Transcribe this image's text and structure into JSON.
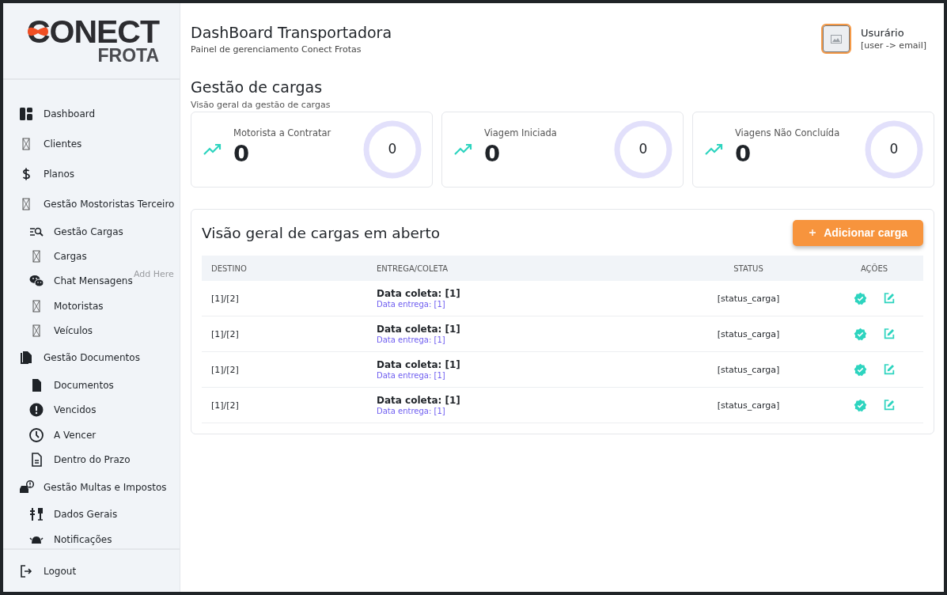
{
  "logo": {
    "wordmark": "CONECT",
    "subtitle": "FROTA"
  },
  "sidebar": {
    "items": [
      {
        "label": "Dashboard",
        "selected": false
      },
      {
        "label": "Clientes",
        "selected": false
      },
      {
        "label": "Planos",
        "selected": false
      },
      {
        "label": "Gestão Mostoristas Terceiro",
        "selected": false,
        "children": [
          {
            "label": "Gestão Cargas",
            "selected": false
          },
          {
            "label": "Cargas",
            "selected": false
          },
          {
            "label": "Chat Mensagens",
            "selected": false,
            "badge": "Add Here"
          },
          {
            "label": "Motoristas",
            "selected": false
          },
          {
            "label": "Veículos",
            "selected": false
          }
        ]
      },
      {
        "label": "Gestão Documentos",
        "selected": false,
        "children": [
          {
            "label": "Documentos",
            "selected": false
          },
          {
            "label": "Vencidos",
            "selected": false
          },
          {
            "label": "A Vencer",
            "selected": false
          },
          {
            "label": "Dentro do Prazo",
            "selected": false
          }
        ]
      },
      {
        "label": "Gestão Multas e Impostos",
        "selected": false,
        "children": [
          {
            "label": "Dados Gerais",
            "selected": false
          },
          {
            "label": "Notificações",
            "selected": false
          }
        ]
      }
    ],
    "footer": "Logout"
  },
  "header": {
    "title": "DashBoard Transportadora",
    "subtitle": "Painel de gerenciamento Conect Frotas"
  },
  "user": {
    "name": "Usurário",
    "email": "[user -> email]"
  },
  "section": {
    "title": "Gestão de cargas",
    "subtitle": "Visão geral da gestão de cargas"
  },
  "stats": [
    {
      "label": "Motorista a Contratar",
      "value": "0",
      "ring_value": "0",
      "level": 0
    },
    {
      "label": "Viagem Iniciada",
      "value": "0",
      "ring_value": "0",
      "level": 0
    },
    {
      "label": "Viagens Não Concluída",
      "value": "0",
      "ring_value": "0",
      "level": 0
    }
  ],
  "panel": {
    "title": "Visão geral de cargas em aberto",
    "add_button": "Adicionar carga",
    "table": {
      "columns": [
        "DESTINO",
        "ENTREGA/COLETA",
        "STATUS",
        "AÇÕES"
      ],
      "rows": [
        {
          "destino": "[1]/[2]",
          "coleta": "Data coleta: [1]",
          "entrega": "Data entrega: [1]",
          "status": "[status_carga]"
        },
        {
          "destino": "[1]/[2]",
          "coleta": "Data coleta: [1]",
          "entrega": "Data entrega: [1]",
          "status": "[status_carga]"
        },
        {
          "destino": "[1]/[2]",
          "coleta": "Data coleta: [1]",
          "entrega": "Data entrega: [1]",
          "status": "[status_carga]"
        },
        {
          "destino": "[1]/[2]",
          "coleta": "Data coleta: [1]",
          "entrega": "Data entrega: [1]",
          "status": "[status_carga]"
        }
      ]
    }
  }
}
